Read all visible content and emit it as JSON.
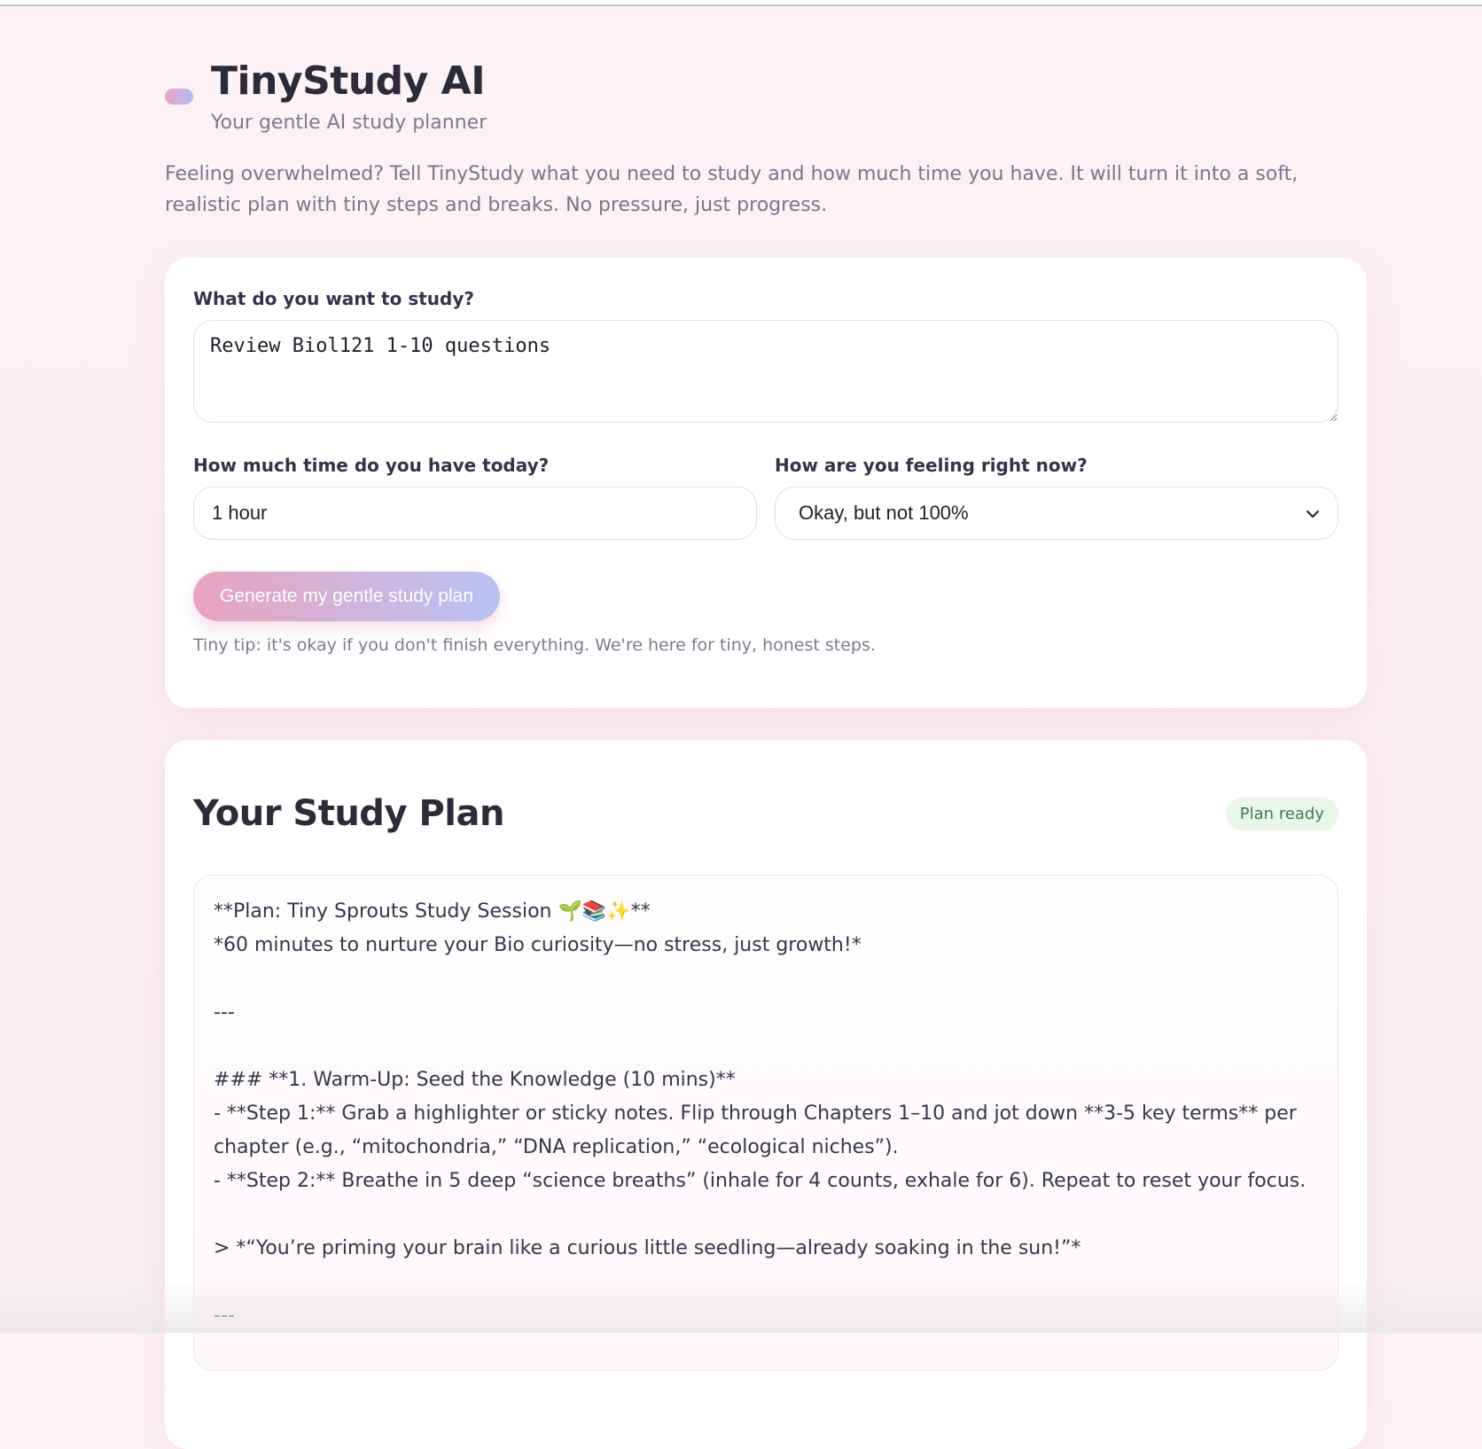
{
  "app": {
    "title": "TinyStudy AI",
    "subtitle": "Your gentle AI study planner",
    "intro": "Feeling overwhelmed? Tell TinyStudy what you need to study and how much time you have. It will turn it into a soft, realistic plan with tiny steps and breaks. No pressure, just progress."
  },
  "form": {
    "study_label": "What do you want to study?",
    "study_value": "Review Biol121 1-10 questions",
    "time_label": "How much time do you have today?",
    "time_value": "1 hour",
    "feeling_label": "How are you feeling right now?",
    "feeling_value": "Okay, but not 100%",
    "generate_label": "Generate my gentle study plan",
    "tip": "Tiny tip: it's okay if you don't finish everything. We're here for tiny, honest steps."
  },
  "plan": {
    "title": "Your Study Plan",
    "status": "Plan ready",
    "lines": [
      "**Plan: Tiny Sprouts Study Session 🌱📚✨**",
      "*60 minutes to nurture your Bio curiosity—no stress, just growth!*",
      "",
      "---",
      "",
      "### **1. Warm-Up: Seed the Knowledge (10 mins)**",
      "- **Step 1:** Grab a highlighter or sticky notes. Flip through Chapters 1–10 and jot down **3-5 key terms** per chapter (e.g., “mitochondria,” “DNA replication,” “ecological niches”).",
      "- **Step 2:** Breathe in 5 deep “science breaths” (inhale for 4 counts, exhale for 6). Repeat to reset your focus.",
      "",
      "> *“You’re priming your brain like a curious little seedling—already soaking in the sun!”*",
      "",
      "---"
    ]
  },
  "colors": {
    "accent_pink": "#e8a3bf",
    "accent_blue": "#b9c2f3",
    "badge_bg": "#e8f7e8",
    "badge_text": "#3f7a4a"
  }
}
